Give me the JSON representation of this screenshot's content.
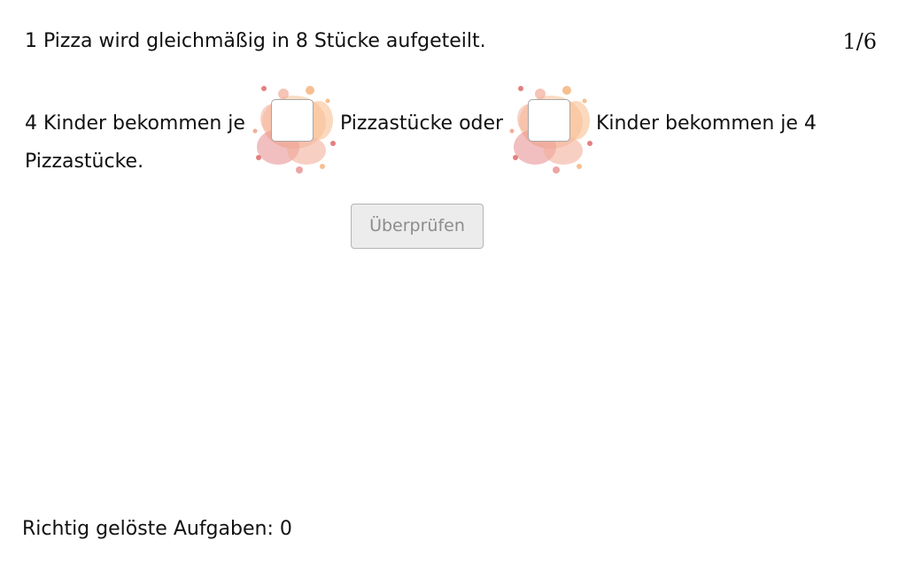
{
  "task": {
    "intro": "1 Pizza wird gleichmäßig in 8 Stücke aufgeteilt.",
    "counter": "1/6"
  },
  "question": {
    "part1": "4 Kinder bekommen je",
    "blank1_value": "",
    "part2": "Pizzastücke oder",
    "blank2_value": "",
    "part3": "Kinder bekommen je 4",
    "part4": "Pizzastücke."
  },
  "check_button": {
    "label": "Überprüfen"
  },
  "score": {
    "text": "Richtig gelöste Aufgaben: 0"
  },
  "colors": {
    "splash_primary": "#f0a088",
    "splash_secondary": "#e06a6a",
    "splash_accent": "#f6b47e",
    "button_bg": "#ececec",
    "button_text": "#8c8c8c"
  }
}
